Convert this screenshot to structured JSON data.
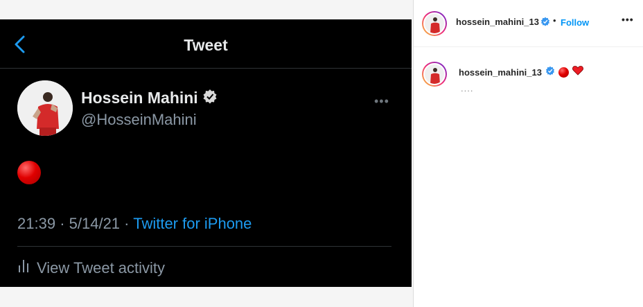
{
  "tweet": {
    "title": "Tweet",
    "name": "Hossein Mahini",
    "handle": "@HosseinMahini",
    "more_icon": "more-horizontal-icon",
    "body_emoji": "red-circle",
    "time": "21:39",
    "date": "5/14/21",
    "separator": "·",
    "source": "Twitter for iPhone",
    "activity_label": "View Tweet activity",
    "colors": {
      "background": "#000000",
      "link": "#1d9bf0",
      "muted": "#8b98a5",
      "verified": "#d9d9d9"
    }
  },
  "instagram": {
    "username": "hossein_mahini_13",
    "dot": "•",
    "follow_label": "Follow",
    "options": "•••",
    "caption_username": "hossein_mahini_13",
    "caption_emojis": [
      "red-circle",
      "red-heart"
    ],
    "caption_ellipsis": "....",
    "colors": {
      "follow": "#0095f6",
      "verified": "#3897f0",
      "heart": "#ed1c24"
    }
  }
}
